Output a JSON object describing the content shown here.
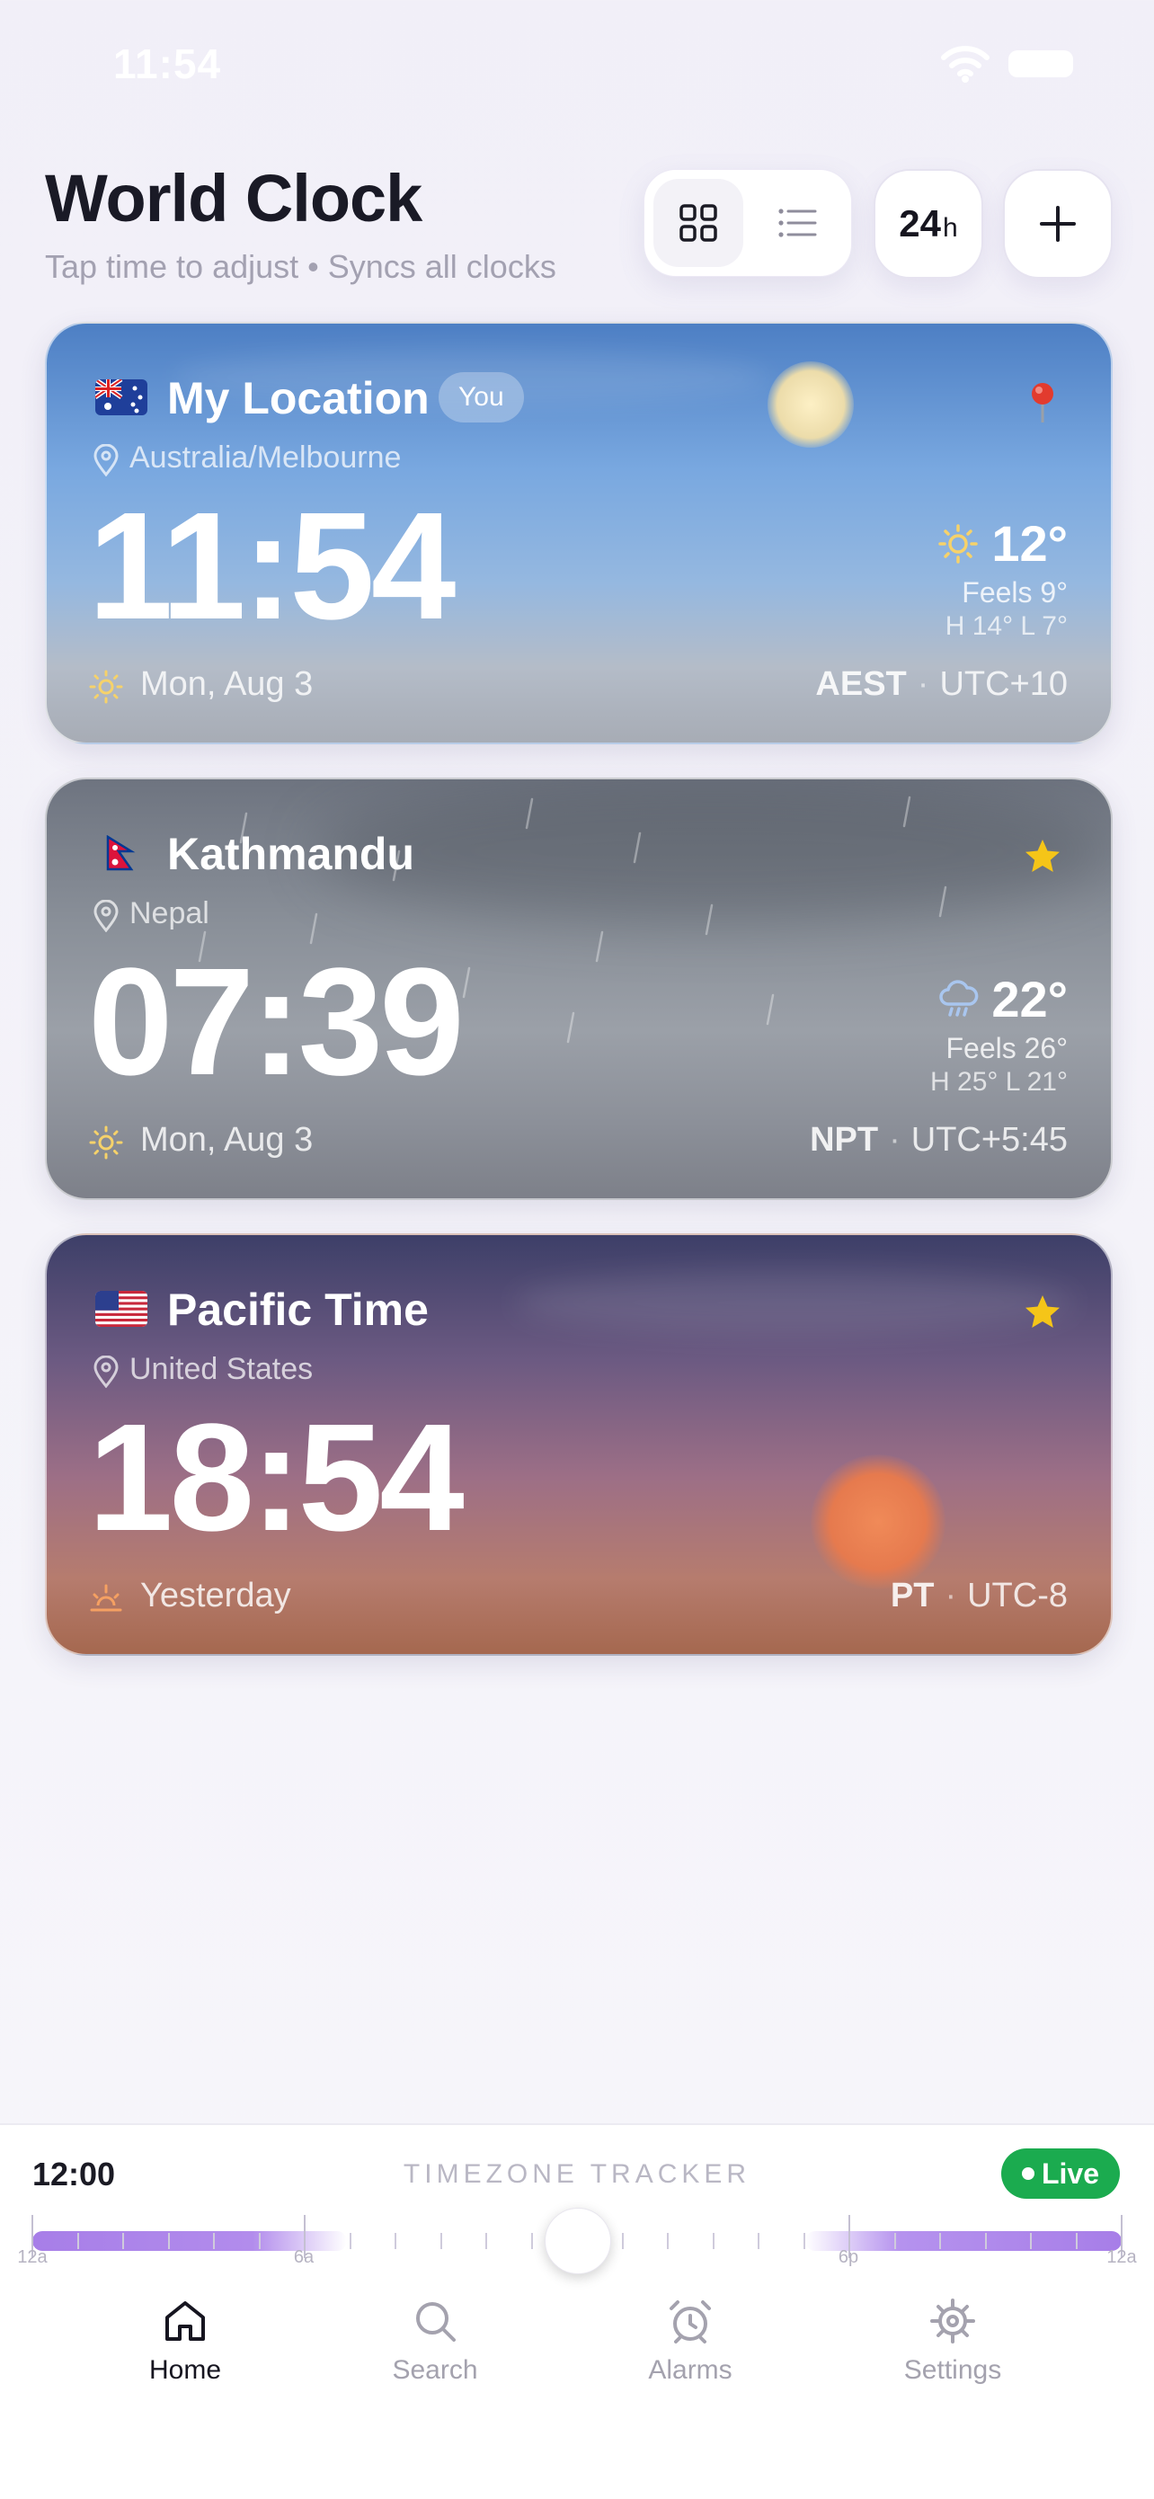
{
  "status_bar": {
    "time": "11:54"
  },
  "header": {
    "title": "World Clock",
    "subtitle": "Tap time to adjust • Syncs all clocks",
    "view_toggle": {
      "active": "grid-view",
      "options": [
        "grid-view",
        "list-view"
      ]
    },
    "time_format_button": {
      "number": "24",
      "unit": "h"
    },
    "add_button_icon": "plus-icon"
  },
  "clocks": [
    {
      "flag": "australia-flag",
      "city": "My Location",
      "badge": "You",
      "region": "Australia/Melbourne",
      "time": "11:54",
      "day_icon": "sun-icon",
      "day": "Mon, Aug 3",
      "tz_abbr": "AEST",
      "utc_offset": "UTC+10",
      "corner_icon": "pin-icon",
      "weather": {
        "icon": "sun-icon",
        "temp": "12°",
        "feels": "Feels 9°",
        "hilo": "H 14° L 7°"
      },
      "theme": "daytime-clear"
    },
    {
      "flag": "nepal-flag",
      "city": "Kathmandu",
      "region": "Nepal",
      "time": "07:39",
      "day_icon": "sun-icon",
      "day": "Mon, Aug 3",
      "tz_abbr": "NPT",
      "utc_offset": "UTC+5:45",
      "corner_icon": "star-icon",
      "weather": {
        "icon": "rain-cloud-icon",
        "temp": "22°",
        "feels": "Feels 26°",
        "hilo": "H 25° L 21°"
      },
      "theme": "rainy-overcast"
    },
    {
      "flag": "us-flag",
      "city": "Pacific Time",
      "region": "United States",
      "time": "18:54",
      "day_icon": "sunset-icon",
      "day": "Yesterday",
      "tz_abbr": "PT",
      "utc_offset": "UTC-8",
      "corner_icon": "star-icon",
      "theme": "sunset"
    }
  ],
  "tracker": {
    "current_time": "12:00",
    "title": "TIMEZONE TRACKER",
    "live_label": "Live",
    "tick_labels": [
      "12a",
      "6a",
      "6p",
      "12a"
    ],
    "position_fraction": 0.5
  },
  "tabs": [
    {
      "label": "Home",
      "icon": "home-icon",
      "active": true
    },
    {
      "label": "Search",
      "icon": "search-icon",
      "active": false
    },
    {
      "label": "Alarms",
      "icon": "alarm-clock-icon",
      "active": false
    },
    {
      "label": "Settings",
      "icon": "gear-icon",
      "active": false
    }
  ],
  "colors": {
    "accent_purple": "#a77ee8",
    "live_green": "#1bab4f",
    "star_yellow": "#f5c518"
  }
}
